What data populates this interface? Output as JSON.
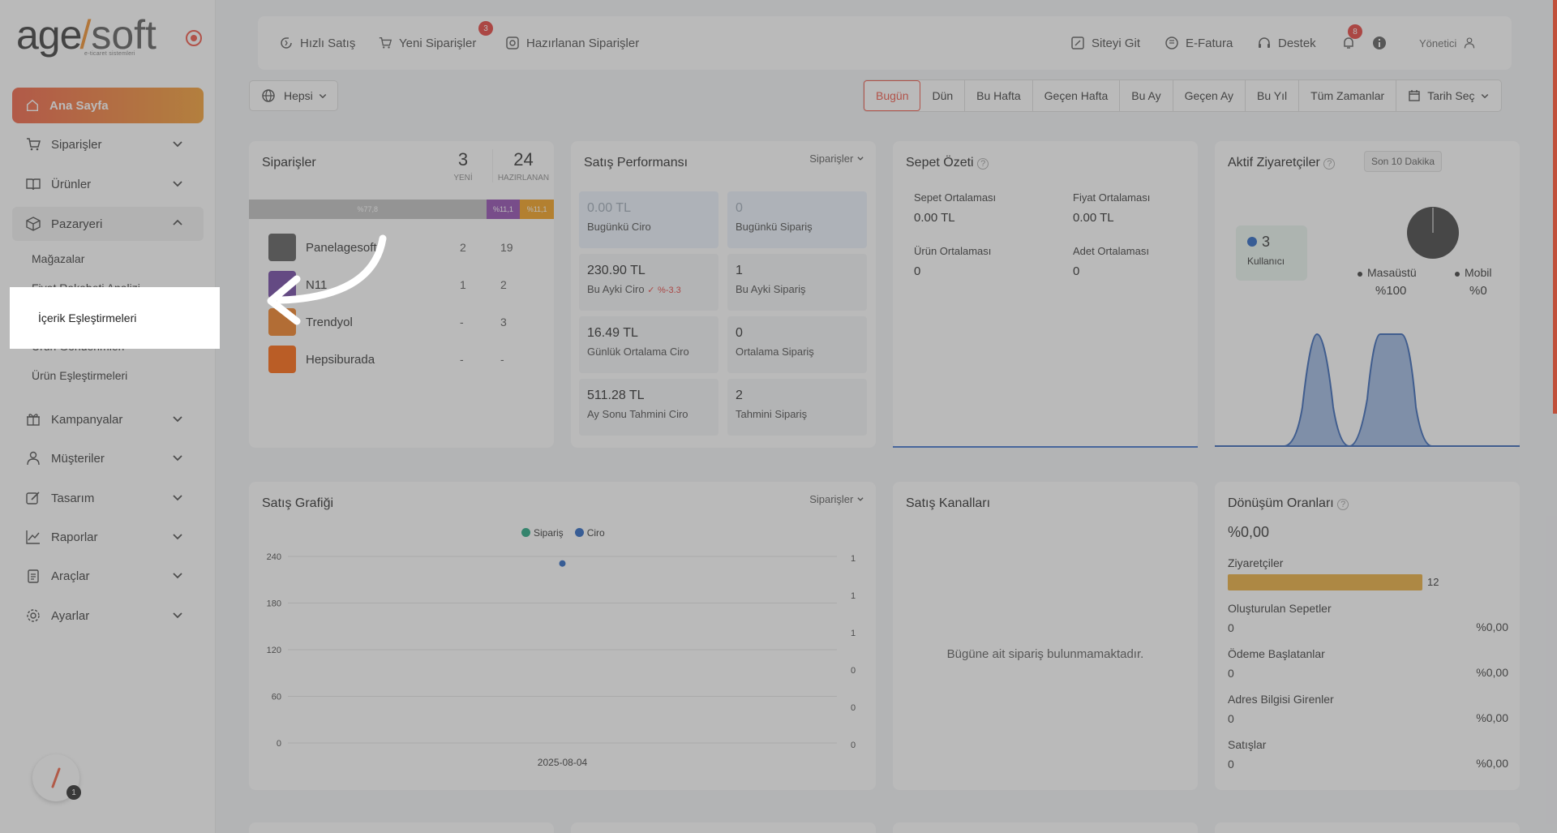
{
  "sidebar": {
    "logo_left": "age",
    "logo_right": "soft",
    "logo_sub": "e-ticaret sistemleri",
    "home": "Ana Sayfa",
    "items": [
      {
        "label": "Siparişler",
        "icon": "cart-icon"
      },
      {
        "label": "Ürünler",
        "icon": "book-icon"
      },
      {
        "label": "Pazaryeri",
        "icon": "box-icon"
      }
    ],
    "sub_items": [
      "Mağazalar",
      "Fiyat Rakabeti Analizi",
      "Ürün Gönderimleri",
      "Ürün Eşleştirmeleri"
    ],
    "highlight": "İçerik Eşleştirmeleri",
    "items2": [
      {
        "label": "Kampanyalar"
      },
      {
        "label": "Müşteriler"
      },
      {
        "label": "Tasarım"
      },
      {
        "label": "Raporlar"
      },
      {
        "label": "Araçlar"
      },
      {
        "label": "Ayarlar"
      }
    ],
    "helper_badge": "1"
  },
  "topbar": {
    "quick_sale": "Hızlı Satış",
    "new_orders": "Yeni Siparişler",
    "new_orders_badge": "3",
    "prepared_orders": "Hazırlanan Siparişler",
    "go_site": "Siteyi Git",
    "einvoice": "E-Fatura",
    "support": "Destek",
    "notif_badge": "8",
    "user": "Yönetici"
  },
  "filters": {
    "scope": "Hepsi",
    "tabs": [
      "Bugün",
      "Dün",
      "Bu Hafta",
      "Geçen Hafta",
      "Bu Ay",
      "Geçen Ay",
      "Bu Yıl",
      "Tüm Zamanlar",
      "Tarih Seç"
    ]
  },
  "orders": {
    "title": "Siparişler",
    "new_count": "3",
    "new_label": "YENİ",
    "prep_count": "24",
    "prep_label": "HAZIRLANAN",
    "bar": [
      {
        "label": "%77,8",
        "value": 77.8,
        "color": "#bdbdbd"
      },
      {
        "label": "%11,1",
        "value": 11.1,
        "color": "#8e44ad"
      },
      {
        "label": "%11,1",
        "value": 11.1,
        "color": "#f39c12"
      }
    ],
    "rows": [
      {
        "name": "Panelagesoft",
        "new": "2",
        "prep": "19"
      },
      {
        "name": "N11",
        "new": "1",
        "prep": "2"
      },
      {
        "name": "Trendyol",
        "new": "-",
        "prep": "3"
      },
      {
        "name": "Hepsiburada",
        "new": "-",
        "prep": "-"
      }
    ]
  },
  "perf": {
    "title": "Satış Performansı",
    "dropdown": "Siparişler",
    "boxes": [
      {
        "v": "0.00 TL",
        "l": "Bugünkü Ciro"
      },
      {
        "v": "0",
        "l": "Bugünkü Sipariş"
      },
      {
        "v": "230.90 TL",
        "l": "Bu Ayki Ciro",
        "delta": "%-3.3"
      },
      {
        "v": "1",
        "l": "Bu Ayki Sipariş"
      },
      {
        "v": "16.49 TL",
        "l": "Günlük Ortalama Ciro"
      },
      {
        "v": "0",
        "l": "Ortalama Sipariş"
      },
      {
        "v": "511.28 TL",
        "l": "Ay Sonu Tahmini Ciro"
      },
      {
        "v": "2",
        "l": "Tahmini Sipariş"
      }
    ]
  },
  "basket": {
    "title": "Sepet Özeti",
    "avg_basket_l": "Sepet Ortalaması",
    "avg_basket_v": "0.00 TL",
    "avg_price_l": "Fiyat Ortalaması",
    "avg_price_v": "0.00 TL",
    "avg_product_l": "Ürün Ortalaması",
    "avg_product_v": "0",
    "avg_qty_l": "Adet Ortalaması",
    "avg_qty_v": "0"
  },
  "visitors": {
    "title": "Aktif Ziyaretçiler",
    "range": "Son 10 Dakika",
    "count": "3",
    "count_label": "Kullanıcı",
    "desktop_l": "Masaüstü",
    "desktop_v": "%100",
    "mobile_l": "Mobil",
    "mobile_v": "%0"
  },
  "sales_chart": {
    "title": "Satış Grafiği",
    "dropdown": "Siparişler",
    "legend_order": "Sipariş",
    "legend_revenue": "Ciro",
    "date": "2025-08-04",
    "left_ticks": [
      "240",
      "180",
      "120",
      "60",
      "0"
    ],
    "right_ticks": [
      "1",
      "1",
      "1",
      "0",
      "0",
      "0"
    ]
  },
  "chart_data": {
    "type": "scatter",
    "title": "Satış Grafiği",
    "categories": [
      "2025-08-04"
    ],
    "series": [
      {
        "name": "Sipariş",
        "values": [
          0
        ],
        "color": "#1aa37a"
      },
      {
        "name": "Ciro",
        "values": [
          230.9
        ],
        "color": "#1f5fbf"
      }
    ],
    "ylim": [
      0,
      240
    ],
    "y2_ticks": [
      "1",
      "1",
      "1",
      "0",
      "0",
      "0"
    ]
  },
  "channels": {
    "title": "Satış Kanalları",
    "empty": "Bügüne ait sipariş bulunmamaktadır."
  },
  "conversion": {
    "title": "Dönüşüm Oranları",
    "rate": "%0,00",
    "visitors_l": "Ziyaretçiler",
    "visitors_v": "12",
    "rows": [
      {
        "name": "Oluşturulan Sepetler",
        "cnt": "0",
        "pct": "%0,00"
      },
      {
        "name": "Ödeme Başlatanlar",
        "cnt": "0",
        "pct": "%0,00"
      },
      {
        "name": "Adres Bilgisi Girenler",
        "cnt": "0",
        "pct": "%0,00"
      },
      {
        "name": "Satışlar",
        "cnt": "0",
        "pct": "%0,00"
      }
    ]
  }
}
